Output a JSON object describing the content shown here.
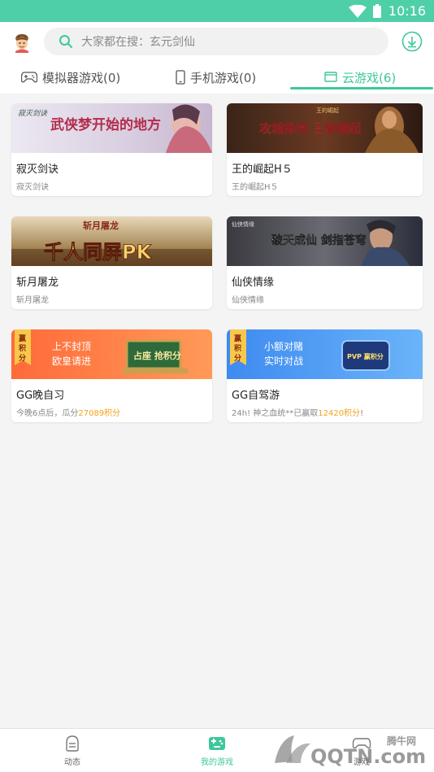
{
  "status_bar": {
    "time": "10:16",
    "accent": "#4fcfa7"
  },
  "header": {
    "search_placeholder": "大家都在搜：玄元剑仙",
    "icons": [
      "avatar",
      "search-icon",
      "download-icon"
    ]
  },
  "tabs": [
    {
      "label": "模拟器游戏(0)",
      "icon": "gamepad-icon",
      "active": false
    },
    {
      "label": "手机游戏(0)",
      "icon": "phone-icon",
      "active": false
    },
    {
      "label": "云游戏(6)",
      "icon": "cloud-screen-icon",
      "active": true
    }
  ],
  "games": [
    {
      "title": "寂灭剑诀",
      "subtitle": "寂灭剑诀",
      "banner_text": "武侠梦开始的地方",
      "banner_logo": "寂灭剑诀"
    },
    {
      "title": "王的崛起H５",
      "subtitle": "王的崛起H５",
      "banner_text": "攻城掠地 王者崛起",
      "banner_logo": "王的崛起"
    },
    {
      "title": "斩月屠龙",
      "subtitle": "斩月屠龙",
      "banner_text": "千人同屏PK",
      "banner_logo": "斩月屠龙"
    },
    {
      "title": "仙侠情缘",
      "subtitle": "仙侠情缘",
      "banner_text": "破天成仙 剑指苍穹",
      "banner_logo": "仙侠情缘"
    },
    {
      "title": "GG晚自习",
      "subtitle_pre": "今晚6点后，瓜分",
      "subtitle_hl": "27089积分",
      "subtitle_post": "",
      "badge": "赢积分",
      "banner_line1": "上不封顶",
      "banner_line2": "欧皇请进",
      "banner_sign": "占座 抢积分"
    },
    {
      "title": "GG自驾游",
      "subtitle_pre": "24h! 神之血统**已赢取",
      "subtitle_hl": "12420积分",
      "subtitle_post": "!",
      "badge": "赢积分",
      "banner_line1": "小额对赌",
      "banner_line2": "实时对战",
      "banner_sign": "PVP 赢积分"
    }
  ],
  "bottom_nav": [
    {
      "label": "动态",
      "icon": "feed-icon",
      "active": false
    },
    {
      "label": "我的游戏",
      "icon": "my-games-icon",
      "active": true
    },
    {
      "label": "游戏",
      "icon": "games-icon",
      "active": false
    }
  ],
  "watermark": {
    "brand": "腾牛网",
    "text": "QQTN.com"
  },
  "colors": {
    "accent": "#3fc79c",
    "highlight": "#f3a21e"
  }
}
